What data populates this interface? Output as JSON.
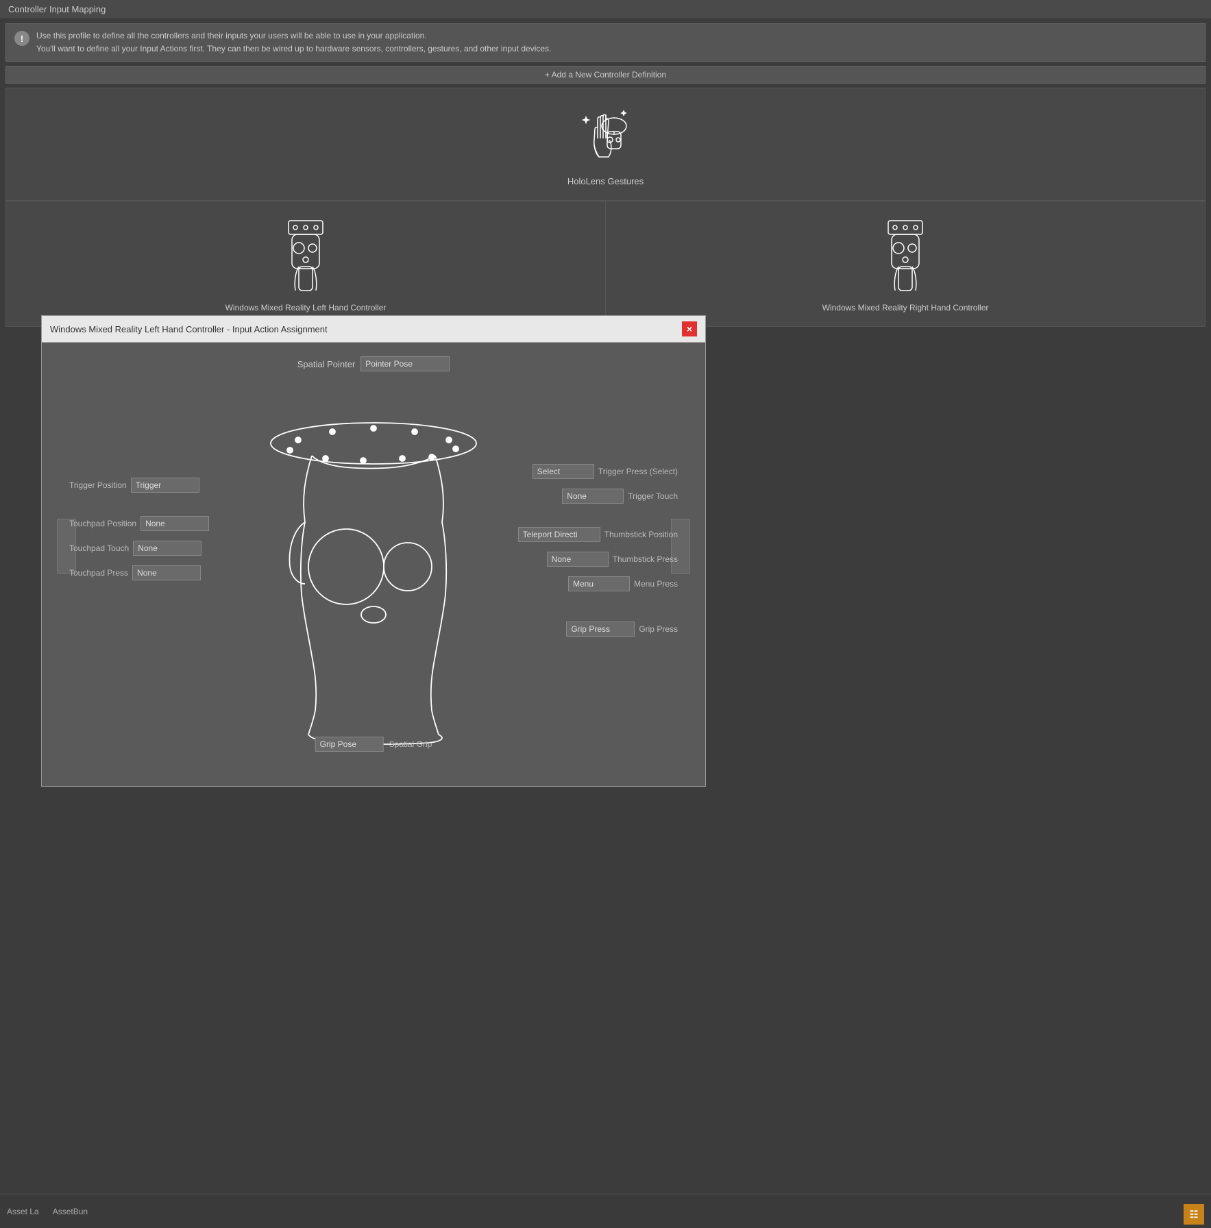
{
  "header": {
    "title": "Controller Input Mapping"
  },
  "info": {
    "icon": "!",
    "line1": "Use this profile to define all the controllers and their inputs your users will be able to use in your application.",
    "line2": "You'll want to define all your Input Actions first. They can then be wired up to hardware sensors, controllers, gestures, and other input devices."
  },
  "add_bar": {
    "label": "+ Add a New Controller Definition"
  },
  "controllers": {
    "hololens": {
      "label": "HoloLens Gestures"
    },
    "left": {
      "label": "Windows Mixed Reality Left Hand Controller"
    },
    "right": {
      "label": "Windows Mixed Reality Right Hand Controller"
    }
  },
  "modal": {
    "title": "Windows Mixed Reality Left Hand Controller - Input Action Assignment",
    "close": "×",
    "spatial_pointer_label": "Spatial Pointer",
    "spatial_pointer_value": "Pointer Pose",
    "left_labels": [
      {
        "id": "trigger-position",
        "label": "Trigger Position",
        "value": "Trigger"
      },
      {
        "id": "touchpad-position",
        "label": "Touchpad Position",
        "value": "None"
      },
      {
        "id": "touchpad-touch",
        "label": "Touchpad Touch",
        "value": "None"
      },
      {
        "id": "touchpad-press",
        "label": "Touchpad Press",
        "value": "None"
      }
    ],
    "right_labels": [
      {
        "id": "trigger-press-select",
        "label": "Trigger Press (Select)",
        "value": "Select"
      },
      {
        "id": "trigger-touch",
        "label": "Trigger Touch",
        "value": "None"
      },
      {
        "id": "thumbstick-position",
        "label": "Thumbstick Position",
        "value": "Teleport Directi"
      },
      {
        "id": "thumbstick-press",
        "label": "Thumbstick Press",
        "value": "None"
      },
      {
        "id": "menu-press",
        "label": "Menu Press",
        "value": "Menu"
      },
      {
        "id": "grip-press",
        "label": "Grip Press",
        "value": "Grip Press"
      }
    ],
    "bottom_label": {
      "label": "Spatial Grip",
      "value": "Grip Pose"
    }
  },
  "bottom": {
    "asset_label": "Asset La",
    "asset_bundle": "AssetBun"
  },
  "colors": {
    "accent": "#e03030",
    "bg_dark": "#3c3c3c",
    "bg_panel": "#484848",
    "bg_modal": "#5a5a5a",
    "modal_header": "#e8e8e8",
    "select_bg": "#6a6a6a",
    "text_light": "#ddd",
    "text_muted": "#bbb"
  }
}
